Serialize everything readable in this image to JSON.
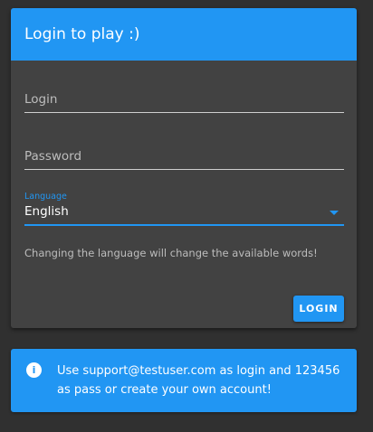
{
  "login_card": {
    "title": "Login to play :)",
    "login_placeholder": "Login",
    "password_placeholder": "Password",
    "language_label": "Language",
    "language_value": "English",
    "helper_text": "Changing the language will change the available words!",
    "login_button": "LOGIN"
  },
  "info": {
    "icon": "info-icon",
    "text": "Use support@testuser.com as login and 123456 as pass or create your own account!"
  },
  "colors": {
    "background": "#303030",
    "card": "#424242",
    "accent": "#2196f3"
  }
}
